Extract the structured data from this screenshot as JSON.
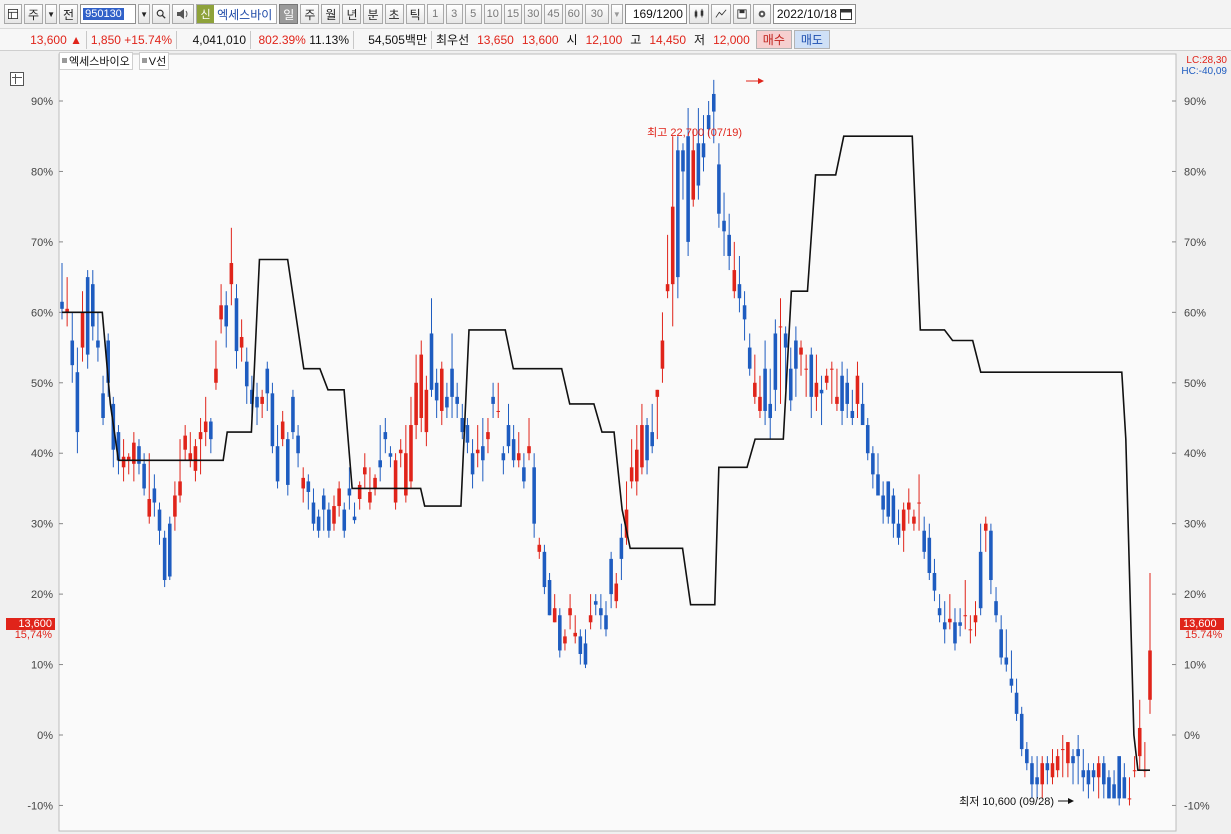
{
  "toolbar": {
    "period_weekly": "주",
    "prev_label": "전",
    "stock_code": "950130",
    "stock_badge": "신",
    "stock_name": "엑세스바이",
    "period_tabs": [
      "일",
      "주",
      "월",
      "년",
      "분",
      "초",
      "틱"
    ],
    "active_period": "일",
    "interval_options": [
      "1",
      "3",
      "5",
      "10",
      "15",
      "30",
      "45",
      "60"
    ],
    "interval_value": "30",
    "bar_count": "169",
    "bar_total": "/1200",
    "date": "2022/10/18"
  },
  "quote": {
    "price": "13,600",
    "arrow": "▲",
    "change": "1,850",
    "change_pct": "+15.74%",
    "volume": "4,041,010",
    "volume_ratio": "802.39%",
    "turnover": "11.13%",
    "amount": "54,505백만",
    "best_ask_label": "최우선",
    "best_ask": "13,650",
    "best_bid": "13,600",
    "open_label": "시",
    "open": "12,100",
    "high_label": "고",
    "high": "14,450",
    "low_label": "저",
    "low": "12,000",
    "buy_label": "매수",
    "sell_label": "매도"
  },
  "legend": {
    "series_name": "엑세스바이오",
    "indicator_name": "V선"
  },
  "axis": {
    "lc_label": "LC:28,30",
    "hc_label": "HC:-40,09",
    "price_tag": "13,600",
    "pct_tag": "15.74%",
    "left_pct_tag": "15,74%"
  },
  "annotations": {
    "high_label": "최고 22,700 (07/19)",
    "low_label": "최저 10,600 (09/28)"
  },
  "colors": {
    "up": "#e0241a",
    "down": "#1e5cc0",
    "line": "#111111",
    "chart_bg": "#fafafa"
  },
  "chart_data": {
    "type": "candlestick",
    "y_unit": "%",
    "ylim": [
      -13,
      95
    ],
    "y_ticks": [
      -10,
      0,
      10,
      20,
      30,
      40,
      50,
      60,
      70,
      80,
      90
    ],
    "y_tick_labels": [
      "-10%",
      "0%",
      "10%",
      "20%",
      "30%",
      "40%",
      "50%",
      "60%",
      "70%",
      "80%",
      "90%"
    ],
    "candles": [
      [
        61.5,
        60.5,
        67,
        59
      ],
      [
        60,
        60.5,
        65,
        58
      ],
      [
        56,
        52.5,
        60,
        50
      ],
      [
        51.5,
        43,
        55,
        40
      ],
      [
        55,
        60,
        63,
        53
      ],
      [
        65,
        54,
        66,
        52
      ],
      [
        64,
        58,
        66,
        56
      ],
      [
        56,
        55,
        60,
        53
      ],
      [
        48.5,
        45,
        51,
        44
      ],
      [
        56,
        50,
        57,
        48
      ],
      [
        47,
        40.5,
        48,
        38
      ],
      [
        43,
        39,
        44,
        37
      ],
      [
        38,
        39.5,
        42,
        36
      ],
      [
        39,
        39.5,
        40,
        37
      ],
      [
        38.5,
        41.5,
        43,
        36
      ],
      [
        41,
        38.5,
        42,
        37
      ],
      [
        38.5,
        35,
        40,
        34
      ],
      [
        31,
        33.5,
        40,
        30
      ],
      [
        35,
        33,
        37,
        31
      ],
      [
        32,
        29,
        33,
        27
      ],
      [
        28,
        22,
        29,
        21
      ],
      [
        30,
        22.5,
        31,
        22
      ],
      [
        31,
        34,
        36,
        29
      ],
      [
        34,
        36,
        42,
        33
      ],
      [
        40.5,
        42.5,
        44,
        39
      ],
      [
        39,
        40,
        43,
        38
      ],
      [
        37.5,
        41,
        42,
        36
      ],
      [
        42,
        43,
        45,
        37
      ],
      [
        43,
        44.5,
        48,
        41
      ],
      [
        44.5,
        42,
        45,
        40
      ],
      [
        50,
        52,
        56,
        49
      ],
      [
        59,
        61,
        64,
        57
      ],
      [
        61,
        58,
        63,
        55
      ],
      [
        64,
        67,
        72,
        61
      ],
      [
        62,
        54.5,
        64,
        52
      ],
      [
        55,
        56.5,
        59,
        53
      ],
      [
        53,
        49.5,
        55,
        47
      ],
      [
        49,
        47,
        51,
        45
      ],
      [
        48,
        46.5,
        50,
        44
      ],
      [
        47,
        48,
        49,
        45
      ],
      [
        52,
        48.5,
        53,
        46
      ],
      [
        48.5,
        41,
        50,
        40
      ],
      [
        41,
        36,
        44,
        35
      ],
      [
        42,
        44.5,
        46,
        41
      ],
      [
        42,
        35.5,
        43,
        34
      ],
      [
        48,
        43,
        49,
        42
      ],
      [
        42.5,
        40,
        44,
        38
      ],
      [
        35,
        36.5,
        38,
        33
      ],
      [
        36,
        34.5,
        37,
        32
      ],
      [
        33,
        30,
        35,
        29
      ],
      [
        31,
        29,
        32,
        28
      ],
      [
        34,
        32,
        35,
        29
      ],
      [
        32,
        29,
        33,
        28
      ],
      [
        30,
        32.5,
        34,
        29
      ],
      [
        32.5,
        35,
        36,
        31
      ],
      [
        32,
        29,
        33,
        28
      ],
      [
        35,
        34,
        38,
        32
      ],
      [
        31,
        30.5,
        33,
        30
      ],
      [
        33.5,
        35.5,
        36,
        32
      ],
      [
        37,
        38,
        40,
        35
      ],
      [
        33,
        34.5,
        38,
        32
      ],
      [
        35,
        36.5,
        37,
        34
      ],
      [
        39,
        38,
        44,
        36
      ],
      [
        43,
        42,
        45,
        40
      ],
      [
        40,
        39.5,
        41,
        38
      ],
      [
        33,
        39,
        40,
        32
      ],
      [
        40,
        40.5,
        42,
        38
      ],
      [
        34,
        40,
        44,
        33
      ],
      [
        36,
        44,
        48,
        35
      ],
      [
        44,
        50,
        54,
        42
      ],
      [
        45,
        54,
        56,
        43
      ],
      [
        43,
        49,
        51,
        41
      ],
      [
        57,
        49,
        62,
        48
      ],
      [
        50,
        47.5,
        52,
        45
      ],
      [
        46,
        52,
        53,
        44
      ],
      [
        48,
        46.5,
        50,
        45
      ],
      [
        52,
        48,
        57,
        45
      ],
      [
        48,
        47,
        50,
        45
      ],
      [
        45,
        43,
        47,
        42
      ],
      [
        44,
        41.5,
        45,
        40
      ],
      [
        40,
        37,
        42,
        35
      ],
      [
        40,
        40.5,
        44,
        38
      ],
      [
        41,
        39,
        45,
        36
      ],
      [
        42,
        43,
        45,
        40
      ],
      [
        48,
        47,
        50,
        45
      ],
      [
        46,
        46,
        50,
        45
      ],
      [
        40,
        39,
        41,
        37
      ],
      [
        44,
        41,
        47,
        40
      ],
      [
        42,
        39,
        44,
        38
      ],
      [
        39,
        40,
        43,
        38
      ],
      [
        38,
        36,
        40,
        35
      ],
      [
        40,
        41,
        45,
        39
      ],
      [
        38,
        30,
        40,
        28
      ],
      [
        26,
        27,
        28,
        25
      ],
      [
        26,
        21,
        27,
        20
      ],
      [
        22,
        17,
        23,
        17
      ],
      [
        16,
        18,
        20,
        16
      ],
      [
        17,
        12,
        18,
        11
      ],
      [
        13,
        14,
        15,
        12
      ],
      [
        17,
        18,
        20,
        15
      ],
      [
        14,
        14.5,
        17,
        13
      ],
      [
        14,
        11.5,
        15,
        10
      ],
      [
        13,
        10,
        15,
        9.5
      ],
      [
        16,
        17,
        20,
        15
      ],
      [
        19,
        18.5,
        20,
        17
      ],
      [
        18,
        17,
        20,
        15
      ],
      [
        17,
        15,
        19,
        14
      ],
      [
        25,
        20,
        26,
        18
      ],
      [
        19,
        21.5,
        23,
        18
      ],
      [
        28,
        25,
        30,
        22
      ],
      [
        28,
        32,
        36,
        27
      ],
      [
        36,
        38,
        42,
        35
      ],
      [
        36,
        40.5,
        44,
        34
      ],
      [
        38,
        44,
        47,
        37
      ],
      [
        44,
        39,
        45,
        37
      ],
      [
        43,
        41,
        47,
        40
      ],
      [
        48,
        49,
        49,
        42
      ],
      [
        52,
        56,
        60,
        50
      ],
      [
        63,
        64,
        71,
        62
      ],
      [
        64,
        75,
        85,
        58
      ],
      [
        83,
        65,
        85,
        62
      ],
      [
        83,
        80,
        84,
        76
      ],
      [
        85,
        70,
        89,
        68
      ],
      [
        76,
        83,
        86,
        75
      ],
      [
        84,
        78,
        89,
        76
      ],
      [
        84,
        82,
        88,
        80
      ],
      [
        88,
        86,
        90,
        85
      ],
      [
        91,
        88.5,
        93,
        84
      ],
      [
        81,
        74,
        84,
        72
      ],
      [
        73,
        71.5,
        77,
        68
      ],
      [
        71,
        68,
        74,
        66
      ],
      [
        63,
        66,
        70,
        62
      ],
      [
        64,
        62,
        68,
        60
      ],
      [
        61,
        59,
        63,
        56
      ],
      [
        55,
        52,
        57,
        51
      ],
      [
        48,
        50,
        54,
        47
      ],
      [
        46,
        48,
        51,
        45
      ],
      [
        52,
        46,
        56,
        44
      ],
      [
        47,
        45,
        52,
        42
      ],
      [
        57,
        49,
        59,
        46
      ],
      [
        58,
        58,
        62,
        47
      ],
      [
        57,
        55,
        58,
        49
      ],
      [
        52,
        47.5,
        55,
        46
      ],
      [
        56,
        52,
        58,
        48
      ],
      [
        54,
        55,
        56,
        51
      ],
      [
        52,
        52,
        54,
        48
      ],
      [
        54,
        48,
        55,
        45
      ],
      [
        48,
        50,
        54,
        46
      ],
      [
        49,
        48.5,
        51,
        44
      ],
      [
        50,
        51,
        52,
        49
      ],
      [
        52,
        52,
        53,
        47
      ],
      [
        47,
        48,
        52,
        46
      ],
      [
        51,
        46,
        53,
        44
      ],
      [
        50,
        47,
        52,
        45
      ],
      [
        46,
        45,
        49,
        44
      ],
      [
        47,
        51,
        53,
        45
      ],
      [
        47,
        44,
        50,
        45
      ],
      [
        44,
        40,
        45,
        39
      ],
      [
        40,
        37,
        41,
        35
      ],
      [
        37,
        34,
        40,
        34
      ],
      [
        34,
        32,
        36,
        30
      ],
      [
        36,
        31,
        36,
        30
      ],
      [
        34,
        30,
        35,
        28
      ],
      [
        30,
        28,
        32,
        27
      ],
      [
        29,
        32,
        33,
        26
      ],
      [
        32,
        33,
        35,
        30
      ],
      [
        30,
        31,
        32,
        29
      ],
      [
        33,
        33,
        37,
        29
      ],
      [
        29,
        26,
        31,
        25
      ],
      [
        28,
        23,
        30,
        22
      ],
      [
        23,
        20.5,
        25,
        19
      ],
      [
        18,
        17,
        20,
        16
      ],
      [
        16,
        15,
        19,
        13
      ],
      [
        16,
        16.5,
        20,
        15
      ],
      [
        16,
        13,
        18,
        12
      ],
      [
        16,
        15.5,
        18,
        14
      ],
      [
        17,
        17,
        22,
        15
      ],
      [
        15,
        15,
        17,
        13
      ],
      [
        16,
        17,
        19,
        14
      ],
      [
        26,
        18,
        30,
        17
      ],
      [
        29,
        30,
        31,
        26
      ],
      [
        29,
        22,
        30,
        20
      ],
      [
        19,
        17,
        21,
        16
      ],
      [
        15,
        11,
        17,
        10
      ],
      [
        11,
        10,
        15,
        9
      ],
      [
        8,
        7,
        12,
        6
      ],
      [
        6,
        3,
        8,
        2
      ],
      [
        3,
        -2,
        4,
        -3
      ],
      [
        -2,
        -4,
        -1,
        -5
      ],
      [
        -4,
        -7,
        -3,
        -9
      ],
      [
        -6,
        -7,
        -3,
        -9
      ],
      [
        -7,
        -4,
        -3,
        -9
      ],
      [
        -4,
        -5,
        -3,
        -7
      ],
      [
        -6,
        -4,
        -2,
        -7
      ],
      [
        -5,
        -3,
        -2,
        -6
      ],
      [
        -2,
        -2,
        0,
        -6
      ],
      [
        -4,
        -1,
        -1,
        -6
      ],
      [
        -3,
        -4,
        -2,
        -7
      ],
      [
        -2,
        -3,
        0,
        -7
      ],
      [
        -5,
        -6,
        -2,
        -8
      ],
      [
        -5,
        -7,
        -4,
        -9
      ],
      [
        -5,
        -6,
        -4,
        -8
      ],
      [
        -6,
        -4,
        -3,
        -9
      ],
      [
        -4,
        -7,
        -3,
        -9
      ],
      [
        -6,
        -9,
        -5,
        -9
      ],
      [
        -7,
        -9,
        -5,
        -9
      ],
      [
        -3,
        -9,
        -4,
        -10
      ],
      [
        -6,
        -9,
        -4,
        -8
      ],
      [
        -9,
        -9,
        -6,
        -10
      ],
      [
        -5,
        -5,
        -3,
        -6
      ],
      [
        -3,
        1,
        5,
        -5
      ],
      [
        -5,
        -5,
        -1,
        -6
      ],
      [
        5,
        12,
        23,
        3
      ]
    ],
    "v_line": [
      [
        0,
        60
      ],
      [
        10,
        60
      ],
      [
        12,
        47
      ],
      [
        14,
        39
      ],
      [
        40,
        39
      ],
      [
        41,
        43
      ],
      [
        47,
        43
      ],
      [
        49,
        67.5
      ],
      [
        56,
        67.5
      ],
      [
        60,
        52
      ],
      [
        64,
        52
      ],
      [
        66,
        49
      ],
      [
        70,
        49
      ],
      [
        72,
        35
      ],
      [
        89,
        35
      ],
      [
        90,
        32.5
      ],
      [
        99,
        32.5
      ],
      [
        101,
        57.5
      ],
      [
        110,
        57.5
      ],
      [
        112,
        52
      ],
      [
        124,
        52
      ],
      [
        126,
        47
      ],
      [
        132,
        47
      ],
      [
        134,
        43
      ],
      [
        137,
        43
      ],
      [
        139,
        32
      ],
      [
        141,
        26.5
      ],
      [
        154,
        26.5
      ],
      [
        156,
        18.5
      ],
      [
        162,
        18.5
      ],
      [
        163,
        38
      ],
      [
        170,
        38
      ],
      [
        172,
        42
      ],
      [
        179,
        42
      ],
      [
        181,
        63
      ],
      [
        185,
        63
      ],
      [
        187,
        79.5
      ],
      [
        192,
        79.5
      ],
      [
        194,
        85
      ],
      [
        211,
        85
      ],
      [
        213,
        57.5
      ],
      [
        219,
        57.5
      ],
      [
        221,
        56
      ],
      [
        226,
        56
      ],
      [
        228,
        51.5
      ],
      [
        263,
        51.5
      ],
      [
        264,
        42
      ],
      [
        266,
        0
      ],
      [
        267,
        -5
      ],
      [
        270,
        -5
      ]
    ],
    "x_range": [
      0,
      270
    ]
  }
}
